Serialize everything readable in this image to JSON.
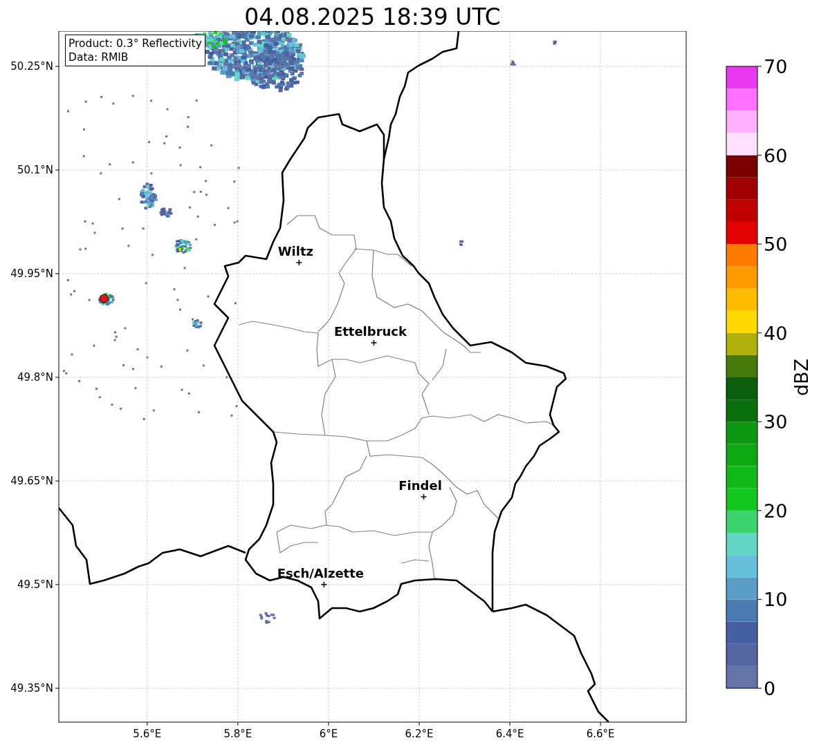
{
  "title": "04.08.2025 18:39 UTC",
  "info_box": {
    "lines": [
      "Product: 0.3° Reflectivity",
      "Data: RMIB"
    ]
  },
  "map": {
    "y_axis_labels": [
      "50.25°N",
      "50.1°N",
      "49.95°N",
      "49.8°N",
      "49.65°N",
      "49.5°N",
      "49.35°N"
    ],
    "x_axis_labels": [
      "5.6°E",
      "5.8°E",
      "6°E",
      "6.2°E",
      "6.4°E",
      "6.6°E"
    ],
    "cities": [
      "Wiltz",
      "Ettelbruck",
      "Findel",
      "Esch/Alzette"
    ]
  },
  "colorbar": {
    "label": "dBZ",
    "ticks": [
      "70",
      "60",
      "50",
      "40",
      "30",
      "20",
      "10",
      "0"
    ]
  }
}
